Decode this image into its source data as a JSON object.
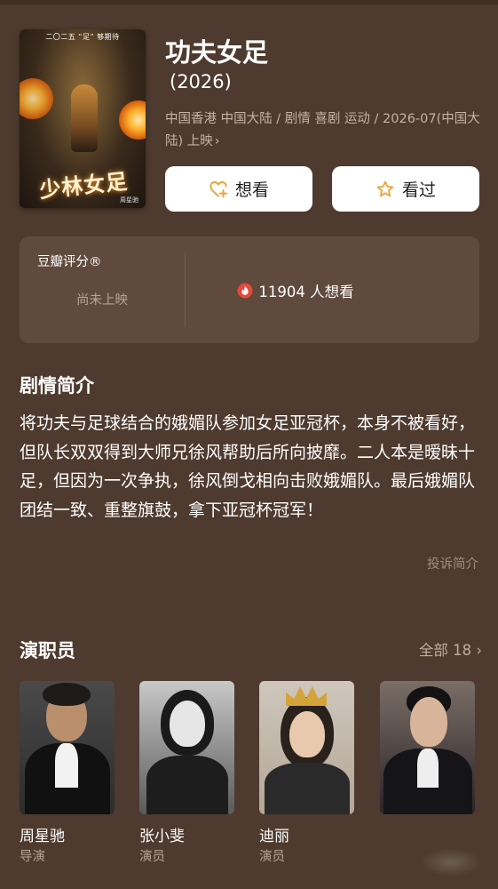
{
  "movie": {
    "title": "功夫女足",
    "year": "(2026)",
    "meta_line": "中国香港 中国大陆 / 剧情 喜剧 运动 / 2026-07(中国大陆) 上映",
    "meta_chevron": "›",
    "poster": {
      "slogan": "二〇二五 “足” 够期待",
      "title_art": "少林女足",
      "credit": "周星驰"
    }
  },
  "actions": {
    "want_label": "想看",
    "seen_label": "看过"
  },
  "rating": {
    "label": "豆瓣评分®",
    "status": "尚未上映",
    "wish_count_text": "11904 人想看"
  },
  "synopsis": {
    "title": "剧情简介",
    "text": "将功夫与足球结合的娥媚队参加女足亚冠杯，本身不被看好，但队长双双得到大师兄徐风帮助后所向披靡。二人本是暧昧十足，但因为一次争执，徐风倒戈相向击败娥媚队。最后娥媚队团结一致、重整旗鼓，拿下亚冠杯冠军！",
    "report_label": "投诉简介"
  },
  "cast": {
    "title": "演职员",
    "all_label": "全部 18",
    "all_chevron": "›",
    "members": [
      {
        "name": "周星驰",
        "role": "导演"
      },
      {
        "name": "张小斐",
        "role": "演员"
      },
      {
        "name": "迪丽",
        "role": "演员"
      },
      {
        "name": "",
        "role": ""
      }
    ]
  },
  "colors": {
    "background": "#4e3a2e",
    "card": "#5f4a3d",
    "accent_orange": "#f0a43a",
    "fire_red": "#e8483a"
  },
  "icons": {
    "want": "heart-plus-icon",
    "seen": "star-icon",
    "wish": "flame-icon",
    "chevron": "chevron-right-icon"
  }
}
